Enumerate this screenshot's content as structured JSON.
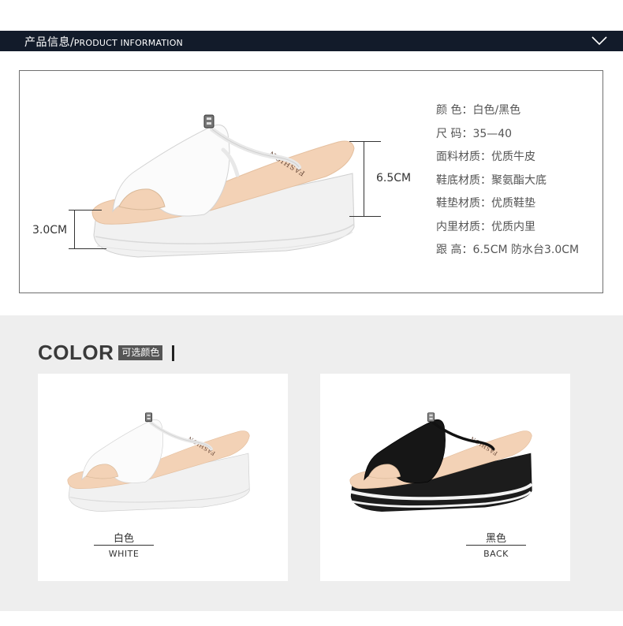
{
  "header": {
    "title_cn": "产品信息",
    "separator": "/",
    "title_en": "PRODUCT INFORMATION"
  },
  "product": {
    "dimensions": {
      "heel_height": "6.5CM",
      "platform_height": "3.0CM"
    },
    "insole_print": "FASHION",
    "specs": [
      {
        "key": "颜  色：",
        "value": "白色/黑色"
      },
      {
        "key": "尺  码：",
        "value": "35—40"
      },
      {
        "key": "面料材质：",
        "value": "优质牛皮"
      },
      {
        "key": "鞋底材质：",
        "value": "聚氨酯大底"
      },
      {
        "key": "鞋垫材质：",
        "value": "优质鞋垫"
      },
      {
        "key": "内里材质：",
        "value": "优质内里"
      },
      {
        "key": "跟  高：",
        "value": "6.5CM  防水台3.0CM"
      }
    ]
  },
  "colors": {
    "heading_en": "COLOR",
    "heading_tag": "可选颜色",
    "options": [
      {
        "name_cn": "白色",
        "name_en": "WHITE",
        "swatch": "#f4f4f4"
      },
      {
        "name_cn": "黑色",
        "name_en": "BACK",
        "swatch": "#1a1a1a"
      }
    ]
  },
  "theme": {
    "header_bg": "#121b2a",
    "section_bg": "#eeeeee",
    "insole": "#f3d2b6"
  }
}
